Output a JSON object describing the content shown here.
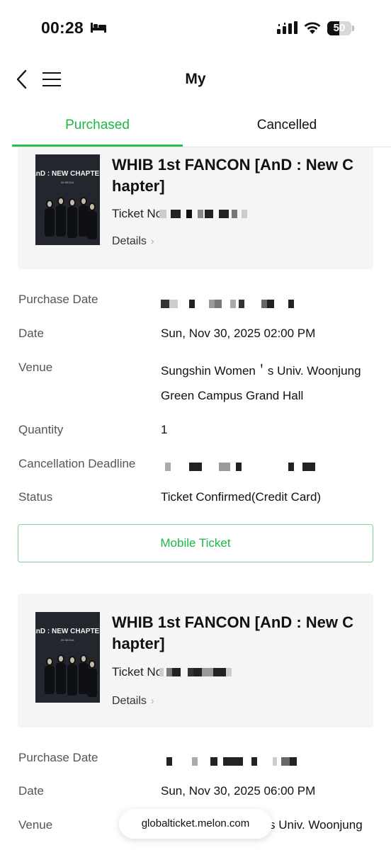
{
  "status_bar": {
    "time": "00:28",
    "battery_level": "50",
    "battery_fraction": 0.5,
    "icons": [
      "bed-icon",
      "signal-icon",
      "wifi-icon",
      "battery-icon"
    ]
  },
  "header": {
    "title": "My",
    "icons": [
      "back-chevron-icon",
      "menu-icon"
    ]
  },
  "tabs": [
    {
      "label": "Purchased",
      "active": true
    },
    {
      "label": "Cancelled",
      "active": false
    }
  ],
  "colors": {
    "accent": "#1fb548",
    "accent_border": "#7fd293",
    "card_bg": "#f5f5f5",
    "label_gray": "#555555"
  },
  "orders": [
    {
      "title": "WHIB 1st FANCON [AnD : New C hapter]",
      "ticket_prefix": "Ticket No",
      "details_label": "Details",
      "poster_text": "AnD : NEW CHAPTER",
      "poster_sub": "IN SEOUL",
      "rows": {
        "purchase_date_label": "Purchase Date",
        "date_label": "Date",
        "date_value": "Sun, Nov 30, 2025 02:00 PM",
        "venue_label": "Venue",
        "venue_line1": "Sungshin Women＇s Univ.  Woonjung",
        "venue_line2": "Green Campus Grand Hall",
        "quantity_label": "Quantity",
        "quantity_value": "1",
        "deadline_label": "Cancellation Deadline",
        "status_label": "Status",
        "status_value": "Ticket Confirmed(Credit Card)"
      },
      "mobile_ticket_label": "Mobile Ticket"
    },
    {
      "title": "WHIB 1st FANCON [AnD : New C hapter]",
      "ticket_prefix": "Ticket No",
      "details_label": "Details",
      "poster_text": "AnD : NEW CHAPTER",
      "poster_sub": "IN SEOUL",
      "rows": {
        "purchase_date_label": "Purchase Date",
        "date_label": "Date",
        "date_value": "Sun, Nov 30, 2025 06:00 PM",
        "venue_label": "Venue",
        "venue_line1": "s Univ.  Woonjung"
      }
    }
  ],
  "url_bar": {
    "text": "globalticket.melon.com"
  }
}
